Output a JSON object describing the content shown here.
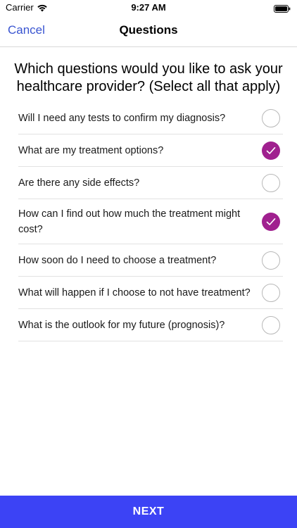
{
  "status_bar": {
    "carrier": "Carrier",
    "time": "9:27 AM"
  },
  "nav": {
    "cancel_label": "Cancel",
    "title": "Questions"
  },
  "heading": "Which questions would you like to ask your healthcare provider? (Select all that apply)",
  "options": [
    {
      "label": "Will I need any tests to confirm my diagnosis?",
      "checked": false
    },
    {
      "label": "What are my treatment options?",
      "checked": true
    },
    {
      "label": "Are there any side effects?",
      "checked": false
    },
    {
      "label": "How can I find out how much the treatment might cost?",
      "checked": true
    },
    {
      "label": "How soon do I need to choose a treatment?",
      "checked": false
    },
    {
      "label": "What will happen if I choose to not have treatment?",
      "checked": false
    },
    {
      "label": "What is the outlook for my future (prognosis)?",
      "checked": false
    }
  ],
  "next_label": "NEXT",
  "colors": {
    "accent": "#3a55d1",
    "checked": "#a0208f",
    "next_button": "#3c43f5"
  }
}
